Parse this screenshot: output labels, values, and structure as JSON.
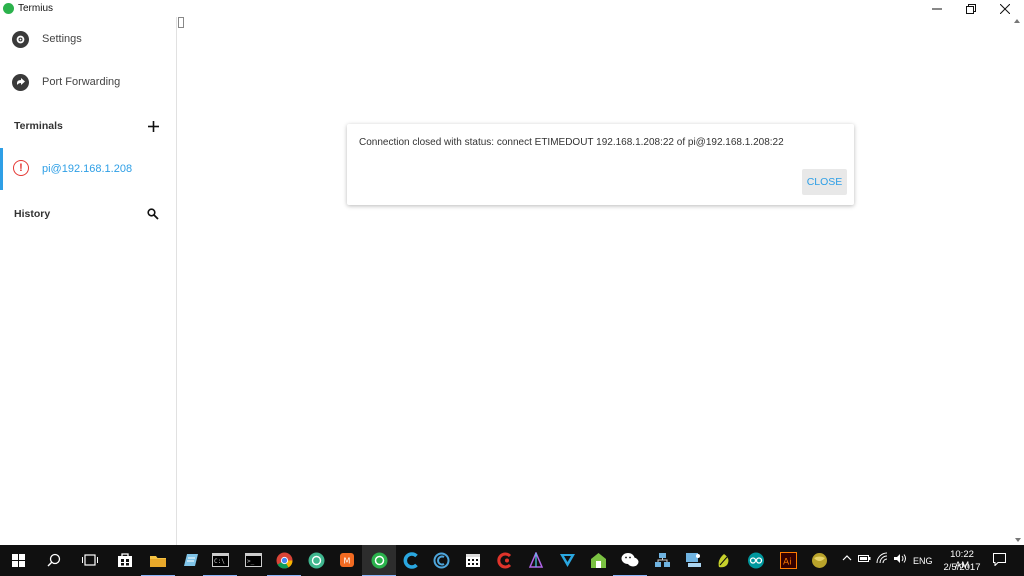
{
  "window": {
    "title": "Termius",
    "icons": {
      "app": "termius-logo-icon",
      "minimize": "minimize-icon",
      "maximize": "restore-icon",
      "close": "close-icon"
    }
  },
  "sidebar": {
    "settings_label": "Settings",
    "port_forwarding_label": "Port Forwarding",
    "terminals_header": "Terminals",
    "terminal_item_label": "pi@192.168.1.208",
    "history_header": "History"
  },
  "dialog": {
    "message": "Connection closed with status: connect ETIMEDOUT 192.168.1.208:22 of pi@192.168.1.208:22",
    "close_label": "CLOSE"
  },
  "taskbar": {
    "language": "ENG",
    "time": "10:22 AM",
    "date": "2/5/2017",
    "pinned_icons": [
      "start-icon",
      "search-icon",
      "task-view-icon",
      "store-icon",
      "file-explorer-icon",
      "notepad-icon",
      "terminal-icon",
      "terminal-icon",
      "chrome-icon",
      "app-icon",
      "app-icon",
      "termius-icon",
      "app-icon",
      "app-icon",
      "calendar-icon",
      "app-icon",
      "app-icon",
      "app-icon",
      "app-icon",
      "wechat-icon",
      "network-icon",
      "app-icon",
      "app-icon",
      "arduino-icon",
      "illustrator-icon",
      "app-icon"
    ]
  },
  "colors": {
    "accent": "#2e9fe6",
    "error": "#e53935",
    "taskbar": "#101010",
    "logo": "#2bb24c"
  }
}
